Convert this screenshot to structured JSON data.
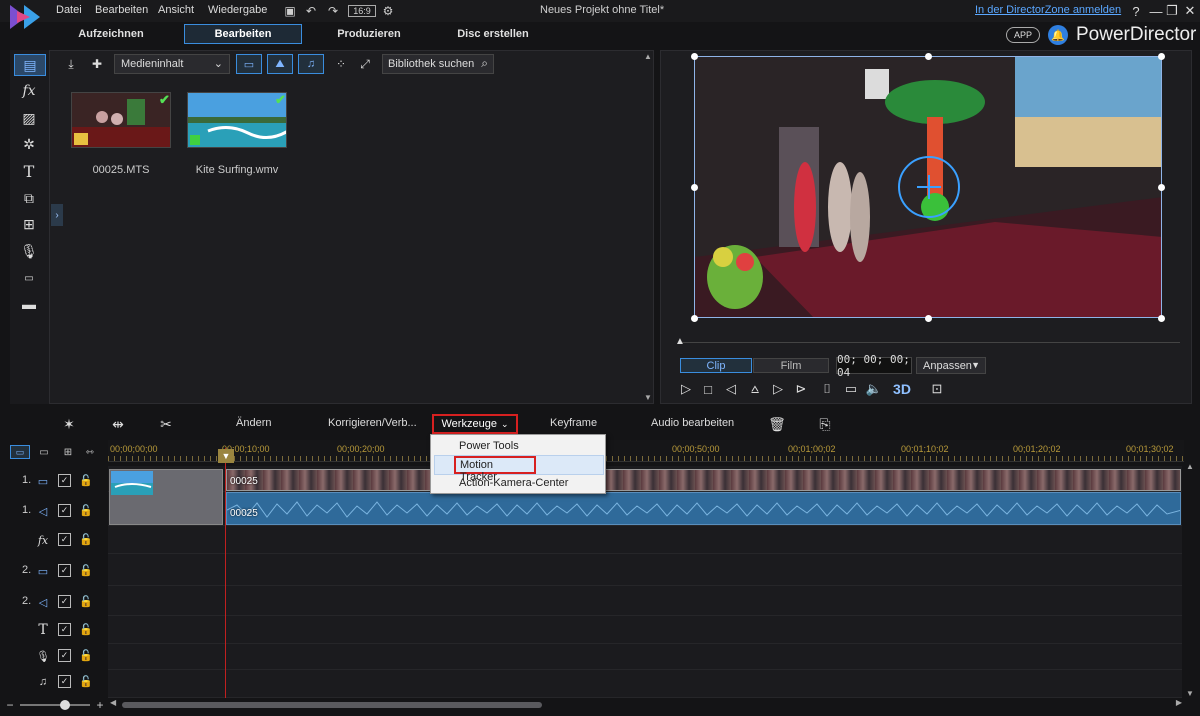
{
  "menu": {
    "items": [
      "Datei",
      "Bearbeiten",
      "Ansicht",
      "Wiedergabe"
    ],
    "aspect": "16:9",
    "project_title": "Neues Projekt ohne Titel*",
    "directorzone_link": "In der DirectorZone anmelden"
  },
  "tabs": [
    "Aufzeichnen",
    "Bearbeiten",
    "Produzieren",
    "Disc erstellen"
  ],
  "active_tab": "Bearbeiten",
  "brand": {
    "app_badge": "APP",
    "name": "PowerDirector"
  },
  "library": {
    "content_dropdown": "Medieninhalt",
    "search_placeholder": "Bibliothek suchen",
    "items": [
      {
        "name": "00025.MTS"
      },
      {
        "name": "Kite Surfing.wmv"
      }
    ]
  },
  "preview": {
    "mode_clip": "Clip",
    "mode_film": "Film",
    "timecode": "00; 00; 00; 04",
    "fit_dropdown": "Anpassen",
    "stereo_3d": "3D"
  },
  "toolbar": {
    "edit": "Ändern",
    "fix": "Korrigieren/Verb...",
    "tools": "Werkzeuge",
    "keyframe": "Keyframe",
    "audio_edit": "Audio bearbeiten"
  },
  "tools_menu": {
    "items": [
      "Power Tools",
      "Motion Tracker",
      "Action-Kamera-Center"
    ],
    "highlighted": "Motion Tracker"
  },
  "ruler": {
    "labels": [
      "00;00;00;00",
      "00;00;10;00",
      "00;00;20;00",
      "00;00;50;00",
      "00;01;00;02",
      "00;01;10;02",
      "00;01;20;02",
      "00;01;30;02"
    ]
  },
  "tracks": [
    {
      "num": "1.",
      "icon": "video-track-icon"
    },
    {
      "num": "1.",
      "icon": "audio-track-icon"
    },
    {
      "num": "",
      "icon": "fx-track-icon"
    },
    {
      "num": "2.",
      "icon": "video-track-icon"
    },
    {
      "num": "2.",
      "icon": "audio-track-icon"
    },
    {
      "num": "",
      "icon": "title-track-icon"
    },
    {
      "num": "",
      "icon": "voice-track-icon"
    },
    {
      "num": "",
      "icon": "music-track-icon"
    }
  ],
  "clips": {
    "video_label": "00025",
    "audio_label": "00025"
  }
}
